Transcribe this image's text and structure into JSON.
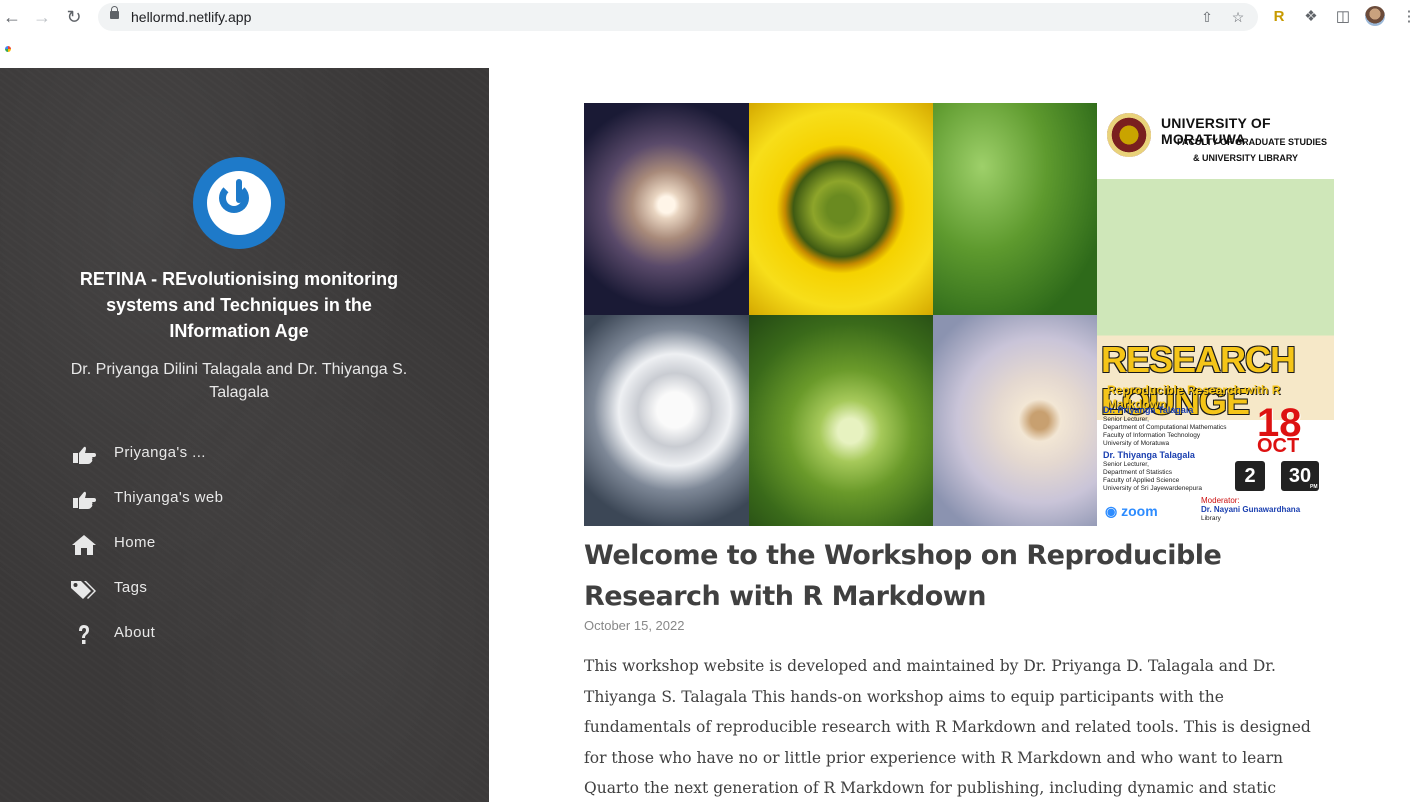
{
  "browser": {
    "url": "hellormd.netlify.app"
  },
  "sidebar": {
    "title": "RETINA - REvolutionising monitoring systems and Techniques in the INformation Age",
    "authors": "Dr. Priyanga Dilini Talagala and Dr. Thiyanga S. Talagala",
    "menu": [
      {
        "label": "Priyanga's ...",
        "icon": "hand-pointing-icon"
      },
      {
        "label": "Thiyanga's web",
        "icon": "hand-pointing-icon"
      },
      {
        "label": "Home",
        "icon": "home-icon"
      },
      {
        "label": "Tags",
        "icon": "tags-icon"
      },
      {
        "label": "About",
        "icon": "question-icon"
      }
    ]
  },
  "banner": {
    "poster": {
      "university": "UNIVERSITY OF MORATUWA",
      "faculty": "FACULTY OF GRADUATE STUDIES",
      "library": "& UNIVERSITY LIBRARY",
      "headline": "RESEARCH LOUNGE",
      "subheadline": "Reproducible Research with R Markdown",
      "speaker1": {
        "name": "Dr. Priyanga Talagala",
        "lines": [
          "Senior Lecturer,",
          "Department of Computational Mathematics",
          "Faculty of Information Technology",
          "University of Moratuwa"
        ]
      },
      "speaker2": {
        "name": "Dr. Thiyanga Talagala",
        "lines": [
          "Senior Lecturer,",
          "Department of Statistics",
          "Faculty of Applied Science",
          "University of Sri Jayewardenepura"
        ]
      },
      "date_day": "18",
      "date_month": "OCT",
      "time_hour": "2",
      "time_min": "30",
      "time_period": "PM",
      "platform": "zoom",
      "moderator_label": "Moderator:",
      "moderator_name": "Dr. Nayani Gunawardhana",
      "moderator_dept": "Library"
    }
  },
  "post": {
    "title": "Welcome to the Workshop on Reproducible Research with R Markdown",
    "date": "October 15, 2022",
    "body": "This workshop website is developed and maintained by Dr. Priyanga D. Talagala and Dr. Thiyanga S. Talagala This hands-on workshop aims to equip participants with the fundamentals of reproducible research with R Markdown and related tools. This is designed for those who have no or little prior experience with R Markdown and who want to learn Quarto the next generation of R Markdown for publishing, including dynamic and static documents and multi-lingual"
  },
  "colors": {
    "sidebar_bg": "#3a3838",
    "logo_blue": "#1e7ac9",
    "heading": "#404040",
    "date": "#888888"
  }
}
